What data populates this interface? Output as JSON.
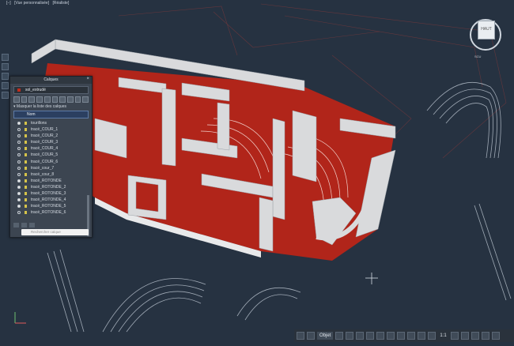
{
  "viewport": {
    "label_parts": [
      "[−]",
      "[Vue personnalisée]",
      "[Réaliste]"
    ]
  },
  "layers_palette": {
    "title": "Calques",
    "current_layer": "sol_extrudé",
    "filter_label": "Masquer la liste des calques",
    "column_header": "Nom",
    "search_placeholder": "Rechercher calque",
    "layers": [
      {
        "name": "tourillons",
        "on": true
      },
      {
        "name": "tracé_COUR_1",
        "on": false
      },
      {
        "name": "tracé_COUR_2",
        "on": false
      },
      {
        "name": "tracé_COUR_3",
        "on": false
      },
      {
        "name": "tracé_COUR_4",
        "on": false
      },
      {
        "name": "tracé_COUR_5",
        "on": false
      },
      {
        "name": "tracé_COUR_6",
        "on": false
      },
      {
        "name": "tracé_cour_7",
        "on": false
      },
      {
        "name": "tracé_cour_8",
        "on": false
      },
      {
        "name": "tracé_ROTONDE",
        "on": true
      },
      {
        "name": "tracé_ROTONDE_2",
        "on": true
      },
      {
        "name": "tracé_ROTONDE_3",
        "on": true
      },
      {
        "name": "tracé_ROTONDE_4",
        "on": true
      },
      {
        "name": "tracé_ROTONDE_5",
        "on": true
      },
      {
        "name": "tracé_ROTONDE_6",
        "on": false
      }
    ]
  },
  "viewcube": {
    "face_label": "HAUT",
    "compass_label": "SCU"
  },
  "status_bar": {
    "snap_mode": "Objet",
    "scale": "1:1"
  },
  "colors": {
    "background": "#263241",
    "floor": "#b1251a",
    "walls": "#d9dadc"
  }
}
